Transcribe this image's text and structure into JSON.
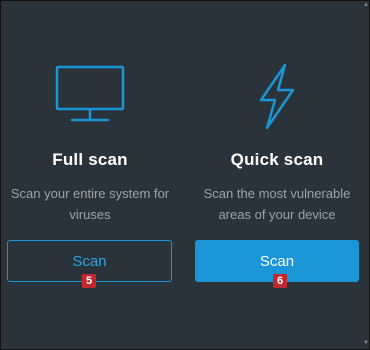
{
  "full_scan": {
    "icon": "monitor-icon",
    "title": "Full scan",
    "description_line1": "Scan your entire system for",
    "description_line2": "viruses",
    "button_label": "Scan",
    "badge": "5"
  },
  "quick_scan": {
    "icon": "lightning-bolt-icon",
    "title": "Quick scan",
    "description_line1": "Scan the most vulnerable",
    "description_line2": "areas of your device",
    "button_label": "Scan",
    "badge": "6"
  },
  "colors": {
    "background": "#2b333a",
    "accent": "#1a95d6",
    "badge": "#c0282d",
    "muted_text": "#9aa3aa"
  }
}
